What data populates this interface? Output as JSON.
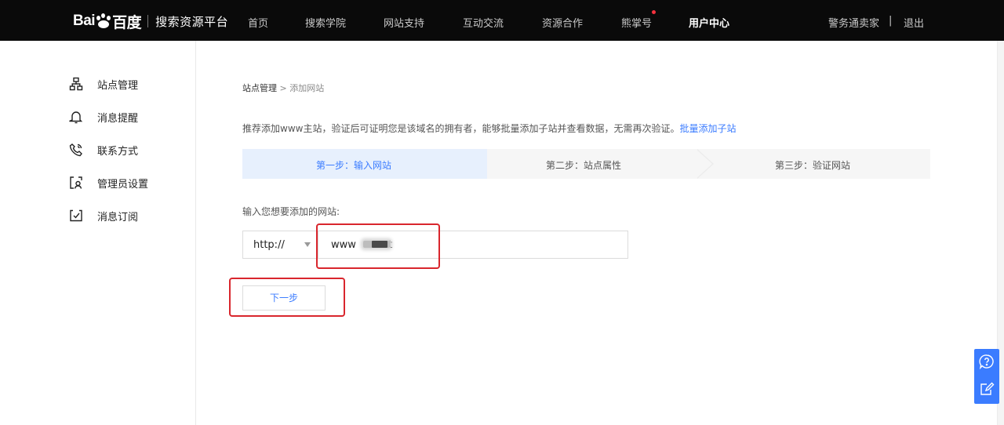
{
  "header": {
    "logo_text": "搜索资源平台",
    "nav": [
      {
        "label": "首页",
        "active": false,
        "dot": false
      },
      {
        "label": "搜索学院",
        "active": false,
        "dot": false
      },
      {
        "label": "网站支持",
        "active": false,
        "dot": false
      },
      {
        "label": "互动交流",
        "active": false,
        "dot": false
      },
      {
        "label": "资源合作",
        "active": false,
        "dot": false
      },
      {
        "label": "熊掌号",
        "active": false,
        "dot": true
      },
      {
        "label": "用户中心",
        "active": true,
        "dot": false
      }
    ],
    "user_name": "警务通卖家",
    "separator": "|",
    "logout": "退出"
  },
  "sidebar": {
    "items": [
      {
        "label": "站点管理",
        "icon": "sitemap-icon"
      },
      {
        "label": "消息提醒",
        "icon": "bell-icon"
      },
      {
        "label": "联系方式",
        "icon": "phone-icon"
      },
      {
        "label": "管理员设置",
        "icon": "admin-icon"
      },
      {
        "label": "消息订阅",
        "icon": "subscribe-icon"
      }
    ]
  },
  "main": {
    "breadcrumb": {
      "root": "站点管理",
      "sep": ">",
      "current": "添加网站"
    },
    "tip_text": "推荐添加www主站，验证后可证明您是该域名的拥有者，能够批量添加子站并查看数据，无需再次验证。",
    "tip_link": "批量添加子站",
    "steps": [
      {
        "label": "第一步：输入网站",
        "active": true
      },
      {
        "label": "第二步：站点属性",
        "active": false
      },
      {
        "label": "第三步：验证网站",
        "active": false
      }
    ],
    "field_label": "输入您想要添加的网站:",
    "protocol": "http://",
    "url_value": "www          t",
    "next_button": "下一步"
  },
  "float_tools": [
    {
      "icon": "help-icon"
    },
    {
      "icon": "feedback-icon"
    }
  ],
  "colors": {
    "accent": "#3b7cff",
    "topbar": "#0a0a0a",
    "highlight": "#d9262d",
    "step_active_bg": "#e7f0fd"
  }
}
